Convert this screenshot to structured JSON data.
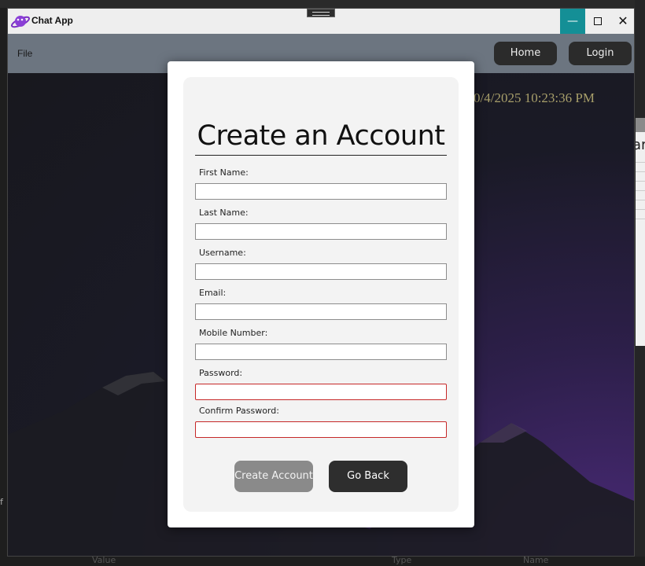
{
  "window": {
    "title": "Chat App",
    "controls": {
      "minimize": "—",
      "close": "✕"
    }
  },
  "menu": {
    "file": "File"
  },
  "nav": {
    "home": "Home",
    "login": "Login"
  },
  "clock_text": "0/4/2025 10:23:36 PM",
  "form": {
    "heading": "Create an Account",
    "fields": [
      {
        "label": "First Name:",
        "value": "",
        "invalid": false
      },
      {
        "label": "Last Name:",
        "value": "",
        "invalid": false
      },
      {
        "label": "Username:",
        "value": "",
        "invalid": false
      },
      {
        "label": "Email:",
        "value": "",
        "invalid": false
      },
      {
        "label": "Mobile Number:",
        "value": "",
        "invalid": false
      },
      {
        "label": "Password:",
        "value": "",
        "invalid": true
      },
      {
        "label": "Confirm Password:",
        "value": "",
        "invalid": true
      }
    ],
    "buttons": {
      "create": "Create Account",
      "back": "Go Back"
    }
  },
  "background": {
    "side_panel_text": "ar",
    "bottom_columns": [
      "Value",
      "Type",
      "Name"
    ],
    "left_edge_text": "f"
  },
  "colors": {
    "accent_min_button": "#148f96",
    "invalid_border": "#c62828",
    "clock": "#a89f6a"
  }
}
